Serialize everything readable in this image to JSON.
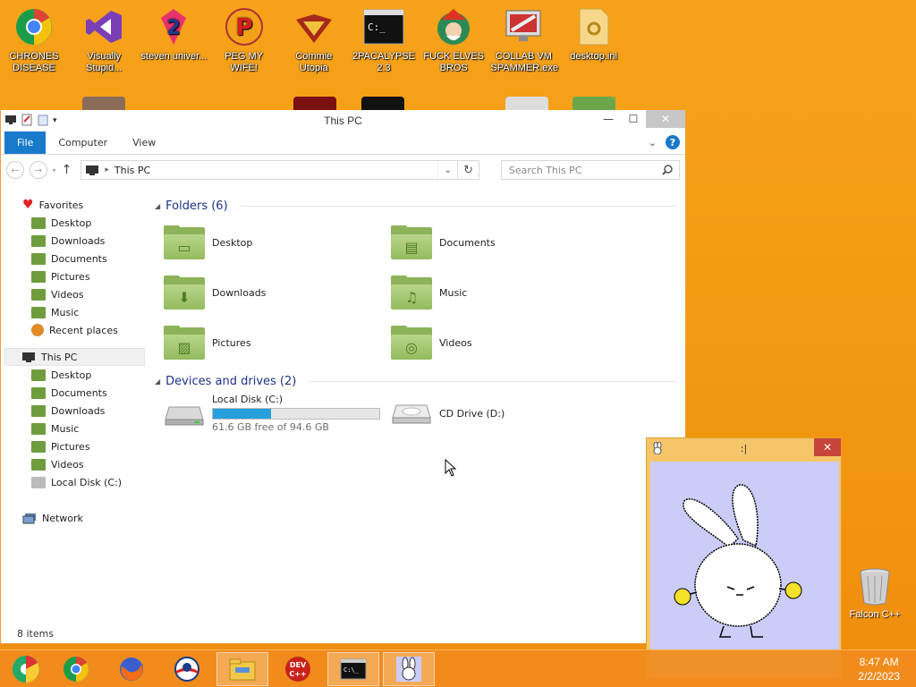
{
  "desktop": {
    "icons": [
      {
        "label": "CHRONES DISEASE",
        "icon": "chrome-icon"
      },
      {
        "label": "Visually Stupid...",
        "icon": "visual-studio-icon"
      },
      {
        "label": "steven univer...",
        "icon": "steven-universe-icon"
      },
      {
        "label": "PEG MY WIFE!",
        "icon": "peggle-icon"
      },
      {
        "label": "Commie Utopia",
        "icon": "commie-emblem-icon"
      },
      {
        "label": "2PACALYPSE 2.3",
        "icon": "cmd-icon"
      },
      {
        "label": "FUCK ELVES BROS",
        "icon": "elf-icon"
      },
      {
        "label": "COLLAB VM SPAMMER.exe",
        "icon": "monitor-icon"
      },
      {
        "label": "desktop.ini",
        "icon": "settings-file-icon"
      }
    ],
    "recycle_label": "Falcon C++"
  },
  "explorer": {
    "title": "This PC",
    "ribbon_tabs": [
      "File",
      "Computer",
      "View"
    ],
    "address": "This PC",
    "search_placeholder": "Search This PC",
    "nav": {
      "favorites": "Favorites",
      "favorites_items": [
        "Desktop",
        "Downloads",
        "Documents",
        "Pictures",
        "Videos",
        "Music",
        "Recent places"
      ],
      "this_pc": "This PC",
      "this_pc_items": [
        "Desktop",
        "Documents",
        "Downloads",
        "Music",
        "Pictures",
        "Videos",
        "Local Disk (C:)"
      ],
      "network": "Network"
    },
    "folders_header": "Folders (6)",
    "folders": [
      "Desktop",
      "Documents",
      "Downloads",
      "Music",
      "Pictures",
      "Videos"
    ],
    "drives_header": "Devices and drives (2)",
    "drives": [
      {
        "name": "Local Disk (C:)",
        "free": "61.6 GB free of 94.6 GB",
        "used_fraction": 0.349
      },
      {
        "name": "CD Drive (D:)"
      }
    ],
    "status": "8 items"
  },
  "popup": {
    "title": ":|"
  },
  "taskbar": {
    "time": "8:47 AM",
    "date": "2/2/2023"
  },
  "colors": {
    "accent": "#1979ca",
    "taskbar": "#f08c1e",
    "folder_green": "#8db35a",
    "popup_bg": "#ccccf9"
  }
}
